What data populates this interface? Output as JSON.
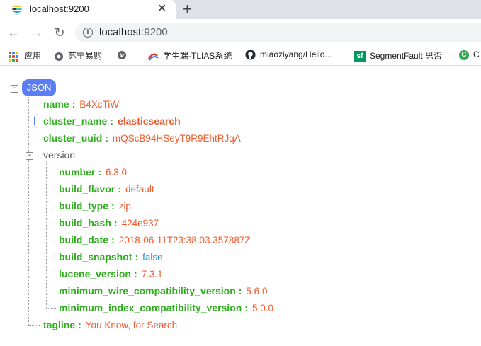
{
  "tab": {
    "title": "localhost:9200",
    "close": "✕",
    "new_tab": "+"
  },
  "toolbar": {
    "back": "←",
    "forward": "→",
    "reload": "↻",
    "url_host": "localhost",
    "url_port": ":9200",
    "info": "i"
  },
  "bookmarks": [
    {
      "label": "应用",
      "icon": "apps-icon"
    },
    {
      "label": "苏宁易购",
      "icon": "gear-icon"
    },
    {
      "label": "",
      "icon": "globe-icon"
    },
    {
      "label": "学生端-TLIAS系统",
      "icon": "swirl-icon"
    },
    {
      "label": "miaoziyang/Hello...",
      "icon": "github-icon"
    },
    {
      "label": "SegmentFault 思否",
      "icon": "segmentfault-icon"
    },
    {
      "label": "C",
      "icon": "c-icon"
    }
  ],
  "json": {
    "badge": "JSON",
    "fields": [
      {
        "key": "name",
        "value": "B4XcTiW"
      },
      {
        "key": "cluster_name",
        "value": "elasticsearch"
      },
      {
        "key": "cluster_uuid",
        "value": "mQScB94HSeyT9R9EhtRJqA"
      }
    ],
    "version_key": "version",
    "version": [
      {
        "key": "number",
        "value": "6.3.0"
      },
      {
        "key": "build_flavor",
        "value": "default"
      },
      {
        "key": "build_type",
        "value": "zip"
      },
      {
        "key": "build_hash",
        "value": "424e937"
      },
      {
        "key": "build_date",
        "value": "2018-06-11T23:38:03.357887Z"
      },
      {
        "key": "build_snapshot",
        "value": "false"
      },
      {
        "key": "lucene_version",
        "value": "7.3.1"
      },
      {
        "key": "minimum_wire_compatibility_version",
        "value": "5.6.0"
      },
      {
        "key": "minimum_index_compatibility_version",
        "value": "5.0.0"
      }
    ],
    "tagline": {
      "key": "tagline",
      "value": "You Know, for Search"
    },
    "colon": ":",
    "collapse_symbol": "−"
  },
  "colors": {
    "key": "#2fae1e",
    "value": "#f15a2b",
    "boolean": "#1f8fd0",
    "badge": "#5b7ef5"
  }
}
